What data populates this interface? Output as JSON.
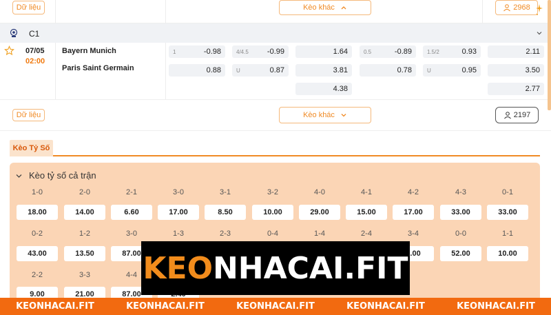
{
  "top_row": {
    "data_label": "Dữ liệu",
    "more_label": "Kèo khác",
    "count": "2968"
  },
  "league": {
    "name": "C1"
  },
  "match": {
    "date": "07/05",
    "time": "02:00",
    "home": "Bayern Munich",
    "away": "Paris Saint Germain",
    "odds": {
      "hdp_home": {
        "handicap": "1",
        "value": "-0.98"
      },
      "hdp_away": {
        "value": "0.88"
      },
      "ou_home": {
        "handicap": "4/4.5",
        "value": "-0.99"
      },
      "ou_away": {
        "handicap": "U",
        "value": "0.87"
      },
      "x12": [
        "1.64",
        "3.81",
        "4.38"
      ],
      "h1_hdp_home": {
        "handicap": "0.5",
        "value": "-0.89"
      },
      "h1_hdp_away": {
        "value": "0.78"
      },
      "h1_ou_home": {
        "handicap": "1.5/2",
        "value": "0.93"
      },
      "h1_ou_away": {
        "handicap": "U",
        "value": "0.95"
      },
      "h1_x12": [
        "2.11",
        "3.50",
        "2.77"
      ]
    }
  },
  "bottom_row": {
    "data_label": "Dữ liệu",
    "more_label": "Kèo khác",
    "count": "2197"
  },
  "tabs": {
    "active": "Kèo Tỷ Số"
  },
  "score_panel": {
    "title": "Kèo tỷ số cả trận",
    "row1": [
      {
        "score": "1-0",
        "odd": "18.00"
      },
      {
        "score": "2-0",
        "odd": "14.00"
      },
      {
        "score": "2-1",
        "odd": "6.60"
      },
      {
        "score": "3-0",
        "odd": "17.00"
      },
      {
        "score": "3-1",
        "odd": "8.50"
      },
      {
        "score": "3-2",
        "odd": "10.00"
      },
      {
        "score": "4-0",
        "odd": "29.00"
      },
      {
        "score": "4-1",
        "odd": "15.00"
      },
      {
        "score": "4-2",
        "odd": "17.00"
      },
      {
        "score": "4-3",
        "odd": "33.00"
      },
      {
        "score": "0-1",
        "odd": "33.00"
      }
    ],
    "row2": [
      {
        "score": "0-2",
        "odd": "43.00"
      },
      {
        "score": "1-2",
        "odd": "13.50"
      },
      {
        "score": "3-0",
        "odd": "87.00"
      },
      {
        "score": "1-3",
        "odd": ""
      },
      {
        "score": "2-3",
        "odd": ""
      },
      {
        "score": "0-4",
        "odd": ""
      },
      {
        "score": "1-4",
        "odd": ""
      },
      {
        "score": "2-4",
        "odd": ""
      },
      {
        "score": "3-4",
        "odd": "7.00"
      },
      {
        "score": "0-0",
        "odd": "52.00"
      },
      {
        "score": "1-1",
        "odd": "10.00"
      }
    ],
    "row3": [
      {
        "score": "2-2",
        "odd": "9.00"
      },
      {
        "score": "3-3",
        "odd": "21.00"
      },
      {
        "score": "4-4",
        "odd": "87.00"
      },
      {
        "score": "",
        "odd": "2.40"
      }
    ]
  },
  "watermark": {
    "part1": "KEO",
    "part2": "NHACAI.FIT"
  },
  "footer": {
    "items": [
      "KEONHACAI.FIT",
      "KEONHACAI.FIT",
      "KEONHACAI.FIT",
      "KEONHACAI.FIT",
      "KEONHACAI.FIT"
    ]
  },
  "colors": {
    "accent": "#f08a24",
    "footer": "#f26a10",
    "panel": "#fbd5b5"
  }
}
